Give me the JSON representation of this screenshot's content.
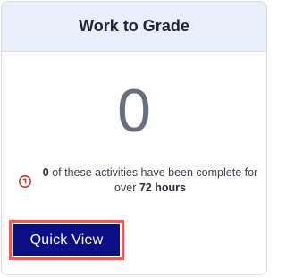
{
  "card": {
    "title": "Work to Grade",
    "count": "0",
    "info": {
      "count": "0",
      "text_before": " of these activities have been complete for over ",
      "hours": "72 hours"
    },
    "quick_view_label": "Quick View"
  },
  "colors": {
    "header_bg": "#e9eefb",
    "button_bg": "#0b0f86",
    "highlight_outline": "#ef5b5b",
    "clock_icon": "#c0392b"
  },
  "icons": {
    "info": "clock-icon"
  }
}
